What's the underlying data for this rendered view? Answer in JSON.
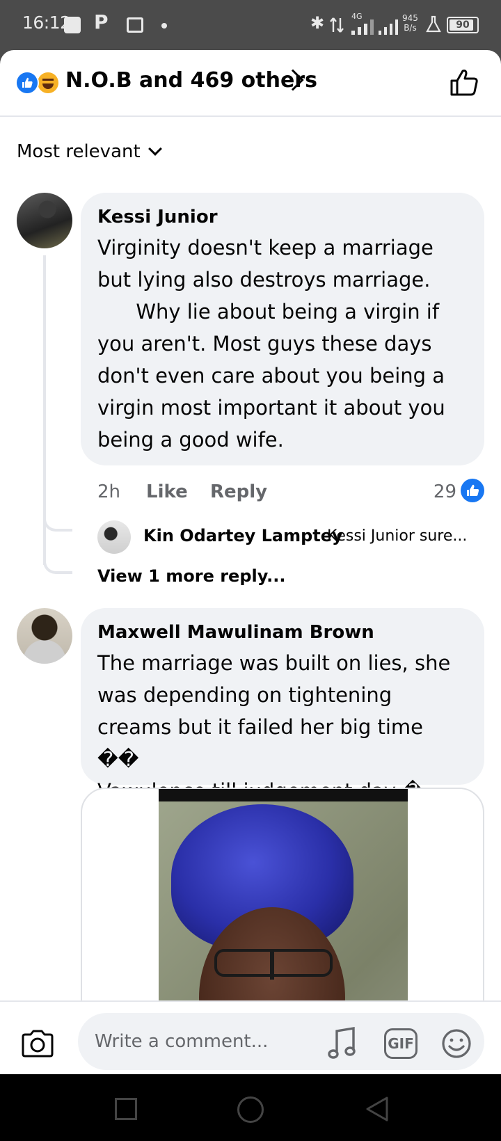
{
  "status_bar": {
    "time": "16:12",
    "network_type": "4G",
    "speed_value": "945",
    "speed_unit": "B/s",
    "battery": "90",
    "icons": [
      "square-notification-icon",
      "p-app-icon",
      "message-icon",
      "dot-icon",
      "bluetooth-icon",
      "data-arrows-icon",
      "signal-icon",
      "signal-icon",
      "flask-icon",
      "battery-icon"
    ]
  },
  "reactions_header": {
    "summary": "N.O.B and 469 others",
    "reaction_icons": [
      "like-reaction-icon",
      "haha-reaction-icon"
    ],
    "like_color": "#1877f2",
    "haha_color": "#f7b125"
  },
  "sort": {
    "label": "Most relevant"
  },
  "comments": [
    {
      "author": "Kessi Junior",
      "text": "Virginity doesn't keep a marriage but lying also destroys marriage.\n      Why lie about being a virgin if you aren't. Most guys these days don't even care about you being a virgin most important it about you being a good wife.",
      "time": "2h",
      "like_label": "Like",
      "reply_label": "Reply",
      "like_count": "29",
      "reply_preview": {
        "author": "Kin Odartey Lamptey",
        "text": "Kessi Junior sure..."
      },
      "view_more": "View 1 more reply..."
    },
    {
      "author": "Maxwell Mawulinam Brown",
      "text": "The marriage was built on lies, she was depending on tightening creams but it failed her big time ��\nVawulence till judgement day �"
    }
  ],
  "composer": {
    "placeholder": "Write a comment...",
    "gif_label": "GIF"
  },
  "colors": {
    "accent": "#1877f2",
    "bubble": "#f0f2f5",
    "muted_text": "#65676b",
    "status_bar_bg": "#4b4b4b"
  }
}
